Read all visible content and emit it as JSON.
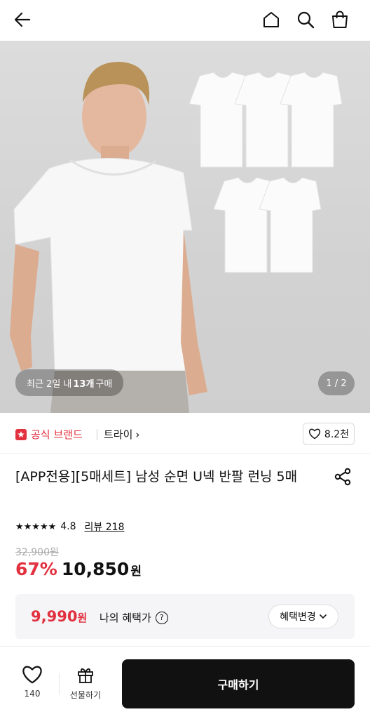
{
  "header": {
    "icons": [
      "back-arrow-icon",
      "home-icon",
      "search-icon",
      "shopping-bag-icon"
    ]
  },
  "hero": {
    "recent_prefix": "최근 2일 내 ",
    "recent_count": "13개",
    "recent_suffix": " 구매",
    "page_indicator": "1 / 2"
  },
  "brand": {
    "badge_label": "공식 브랜드",
    "name": "트라이",
    "name_chevron": "›",
    "likes": "8.2천"
  },
  "product": {
    "title": "[APP전용][5매세트] 남성 순면 U넥 반팔 런닝 5매",
    "stars": "★★★★★",
    "rating": "4.8",
    "review_label": "리뷰 218",
    "original_price": "32,900원",
    "discount": "67%",
    "price": "10,850",
    "price_unit": "원"
  },
  "benefit": {
    "price": "9,990",
    "price_unit": "원",
    "label": "나의 혜택가",
    "info_icon": "?",
    "change_label": "혜택변경"
  },
  "bottom": {
    "wish_count": "140",
    "gift_label": "선물하기",
    "buy_label": "구매하기"
  },
  "colors": {
    "accent": "#e2303f",
    "buy_button": "#111111"
  }
}
